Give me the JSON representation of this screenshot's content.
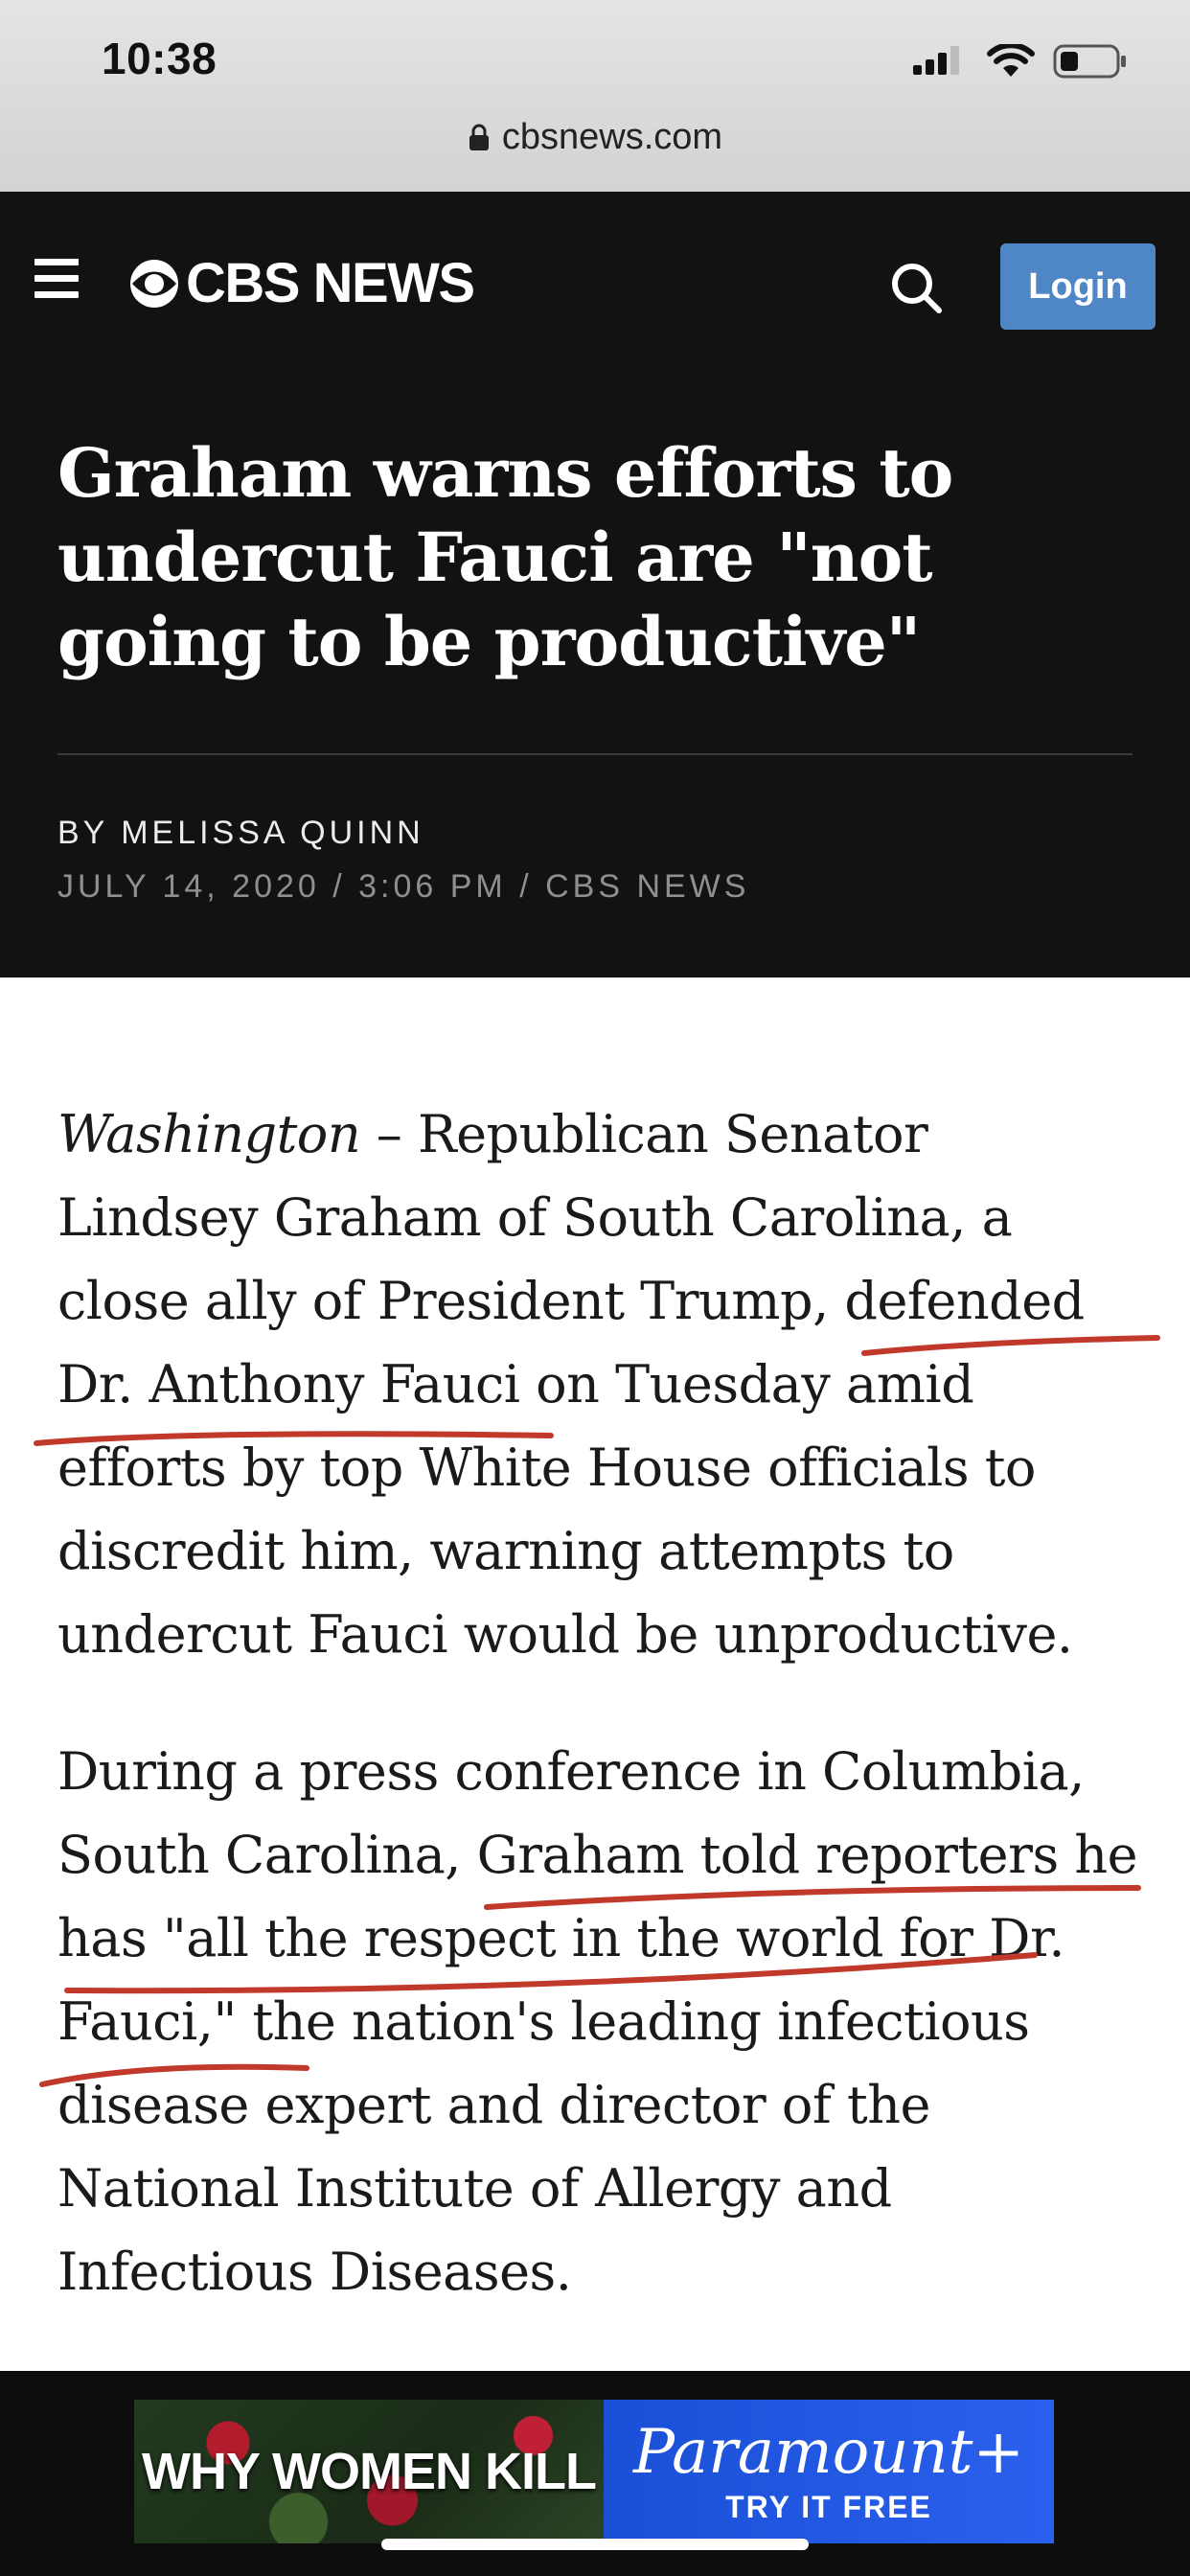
{
  "status_bar": {
    "time": "10:38",
    "url": "cbsnews.com"
  },
  "header": {
    "logo_text": "CBS NEWS",
    "login_label": "Login"
  },
  "article": {
    "headline": "Graham warns efforts to undercut Fauci are \"not going to be productive\"",
    "byline": "BY MELISSA QUINN",
    "dateline": "JULY 14, 2020 / 3:06 PM / CBS NEWS",
    "paragraphs": [
      {
        "place": "Washington",
        "text": " – Republican Senator Lindsey Graham of South Carolina, a close ally of President Trump, defended Dr. Anthony Fauci on Tuesday amid efforts by top White House officials to discredit him, warning attempts to undercut Fauci would be unproductive."
      },
      {
        "text": "During a press conference in Columbia, South Carolina, Graham told reporters he has \"all the respect in the world for Dr. Fauci,\" the nation's leading infectious disease expert and director of the National Institute of Allergy and Infectious Diseases."
      }
    ],
    "annotation_color": "#c0392b"
  },
  "ad": {
    "title": "WHY WOMEN KILL",
    "brand": "Paramount+",
    "cta": "TRY IT FREE"
  }
}
